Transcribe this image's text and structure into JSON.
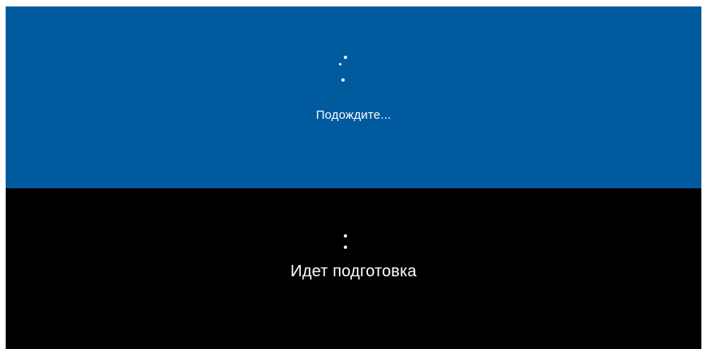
{
  "top_panel": {
    "message": "Подождите...",
    "background_color": "#005a9e",
    "spinner_icon": "loading-dots-icon"
  },
  "bottom_panel": {
    "message": "Идет подготовка",
    "background_color": "#000000",
    "spinner_icon": "loading-dots-icon"
  },
  "text_color": "#ffffff"
}
